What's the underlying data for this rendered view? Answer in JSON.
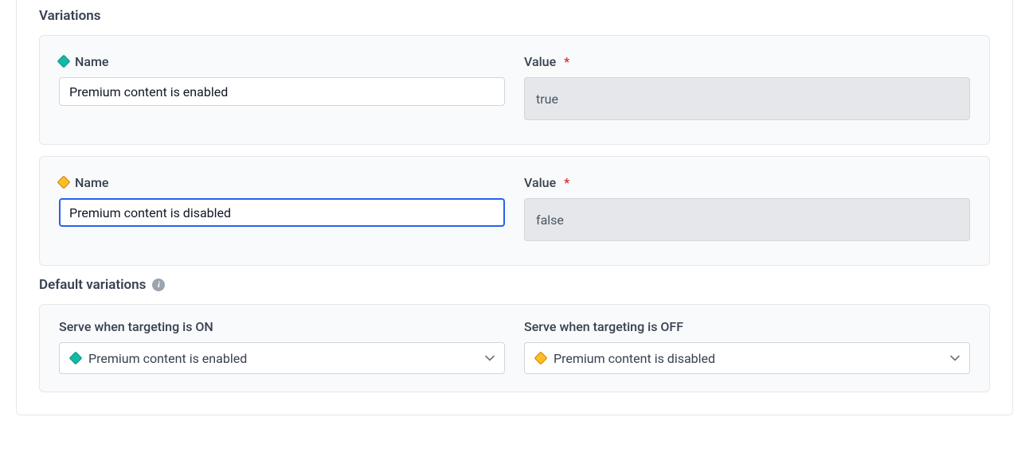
{
  "sections": {
    "variations_title": "Variations",
    "defaults_title": "Default variations"
  },
  "labels": {
    "name": "Name",
    "value": "Value",
    "required_marker": "*",
    "serve_on": "Serve when targeting is ON",
    "serve_off": "Serve when targeting is OFF"
  },
  "variations": [
    {
      "name": "Premium content is enabled",
      "value": "true",
      "color": "teal",
      "focused": false
    },
    {
      "name": "Premium content is disabled",
      "value": "false",
      "color": "amber",
      "focused": true
    }
  ],
  "defaults": {
    "on": {
      "label": "Premium content is enabled",
      "color": "teal"
    },
    "off": {
      "label": "Premium content is disabled",
      "color": "amber"
    }
  }
}
